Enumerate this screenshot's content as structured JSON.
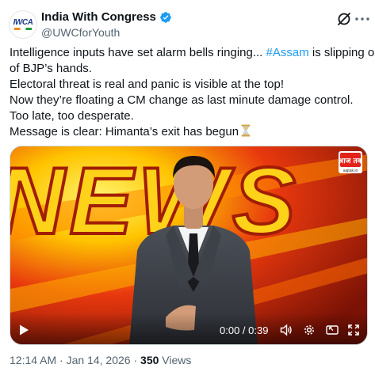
{
  "author": {
    "display_name": "India With Congress",
    "handle": "@UWCforYouth",
    "avatar_text": "IWCA",
    "verified": true
  },
  "tweet": {
    "lines": [
      {
        "text": "Intelligence inputs have set alarm bells ringing... ",
        "hashtag": "#Assam",
        "after": " is slipping out"
      },
      {
        "text": "of BJP’s hands."
      },
      {
        "text": "Electoral threat is real and panic is visible at the top!"
      },
      {
        "text": "Now they’re floating a CM change as last minute damage control."
      },
      {
        "text": "Too late, too desperate."
      },
      {
        "text": "Message is clear: Himanta’s exit has begun"
      }
    ],
    "end_emoji": "hourglass-icon"
  },
  "video": {
    "background_text": "NEWS",
    "channel_logo_text": "आज तक",
    "channel_logo_sub": "aajtak.in",
    "time_display": "0:00 / 0:39"
  },
  "footer": {
    "time": "12:14 AM",
    "separator": " · ",
    "date": "Jan 14, 2026",
    "views_count": "350",
    "views_label": " Views"
  },
  "colors": {
    "accent": "#1d9bf0",
    "text": "#0f1419",
    "secondary": "#536471",
    "video_bg": "#c8200c",
    "video_glow": "#ffd400"
  }
}
